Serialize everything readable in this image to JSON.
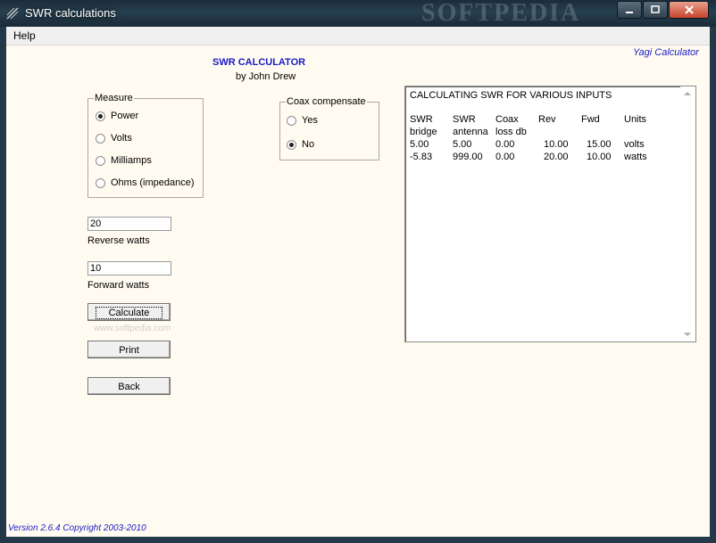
{
  "window": {
    "title": "SWR calculations",
    "watermark": "SOFTPEDIA",
    "minimize_icon": "minimize-icon",
    "maximize_icon": "maximize-icon",
    "close_icon": "close-icon"
  },
  "menu": {
    "help": "Help"
  },
  "header": {
    "yagi_link": "Yagi Calculator",
    "title": "SWR CALCULATOR",
    "author": "by John Drew"
  },
  "measure": {
    "legend": "Measure",
    "options": [
      {
        "label": "Power",
        "checked": true
      },
      {
        "label": "Volts",
        "checked": false
      },
      {
        "label": "Milliamps",
        "checked": false
      },
      {
        "label": "Ohms (impedance)",
        "checked": false
      }
    ]
  },
  "coax": {
    "legend": "Coax compensate",
    "options": [
      {
        "label": "Yes",
        "checked": false
      },
      {
        "label": "No",
        "checked": true
      }
    ]
  },
  "inputs": {
    "reverse_value": "20",
    "reverse_label": "Reverse watts",
    "forward_value": "10",
    "forward_label": "Forward watts"
  },
  "buttons": {
    "calculate": "Calculate",
    "print": "Print",
    "back": "Back"
  },
  "watermark_mid": "www.softpedia.com",
  "output": {
    "heading": "CALCULATING SWR FOR VARIOUS INPUTS",
    "columns_line1": [
      "SWR",
      "SWR",
      "Coax",
      "Rev",
      "Fwd",
      "Units"
    ],
    "columns_line2": [
      "bridge",
      "antenna",
      "loss db",
      "",
      "",
      ""
    ],
    "rows": [
      [
        "5.00",
        "5.00",
        "0.00",
        "10.00",
        "15.00",
        "volts"
      ],
      [
        "-5.83",
        "999.00",
        "0.00",
        "20.00",
        "10.00",
        "watts"
      ]
    ]
  },
  "footer": {
    "version": "Version 2.6.4 Copyright 2003-2010"
  },
  "colors": {
    "client_bg": "#fffbf0",
    "accent_blue": "#1a1ac8"
  }
}
